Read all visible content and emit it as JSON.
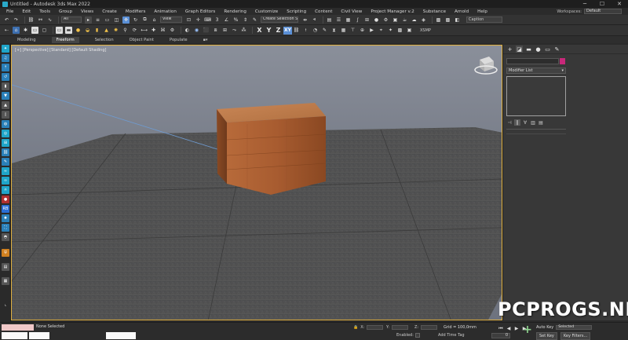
{
  "window": {
    "title": "Untitled - Autodesk 3ds Max 2022",
    "controls": [
      "─",
      "☐",
      "✕"
    ]
  },
  "menubar": {
    "items": [
      "File",
      "Edit",
      "Tools",
      "Group",
      "Views",
      "Create",
      "Modifiers",
      "Animation",
      "Graph Editors",
      "Rendering",
      "Customize",
      "Scripting",
      "Content",
      "Civil View",
      "Project Manager v.2",
      "Substance",
      "Arnold",
      "Help"
    ],
    "workspaces_label": "Workspaces:",
    "workspaces_value": "Default"
  },
  "toolbar": {
    "filter_select": "All",
    "view_select": "View",
    "selection_set": "Create Selection Se",
    "axes": [
      "X",
      "Y",
      "Z",
      "XY"
    ],
    "named_sel": "Caption",
    "xsmp": "XSMP"
  },
  "ribbon": {
    "tabs": [
      "Modeling",
      "Freeform",
      "Selection",
      "Object Paint",
      "Populate"
    ],
    "active_tab": "Freeform",
    "toggle": "▪▾"
  },
  "viewport": {
    "label": "[+] [Perspective] [Standard] [Default Shading]"
  },
  "command_panel": {
    "modifier_list": "Modifier List",
    "object_color": "#c8287a"
  },
  "status": {
    "selection": "None Selected",
    "x_label": "X:",
    "y_label": "Y:",
    "z_label": "Z:",
    "grid": "Grid = 100,0mm",
    "enabled": "Enabled:",
    "add_time_tag": "Add Time Tag",
    "auto_key": "Auto Key",
    "auto_key_value": "Selected",
    "set_key": "Set Key",
    "key_filters": "Key Filters...",
    "time_value": "0"
  },
  "watermark": "PCPROGS.NET"
}
